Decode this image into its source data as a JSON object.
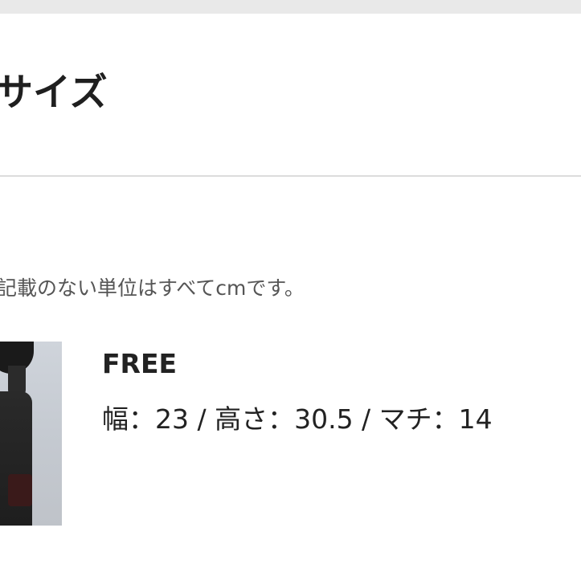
{
  "section": {
    "title": "サイズ",
    "unit_note": "記載のない単位はすべてcmです。"
  },
  "size_entry": {
    "name": "FREE",
    "dimensions": "幅：23 / 高さ：30.5 / マチ：14"
  }
}
